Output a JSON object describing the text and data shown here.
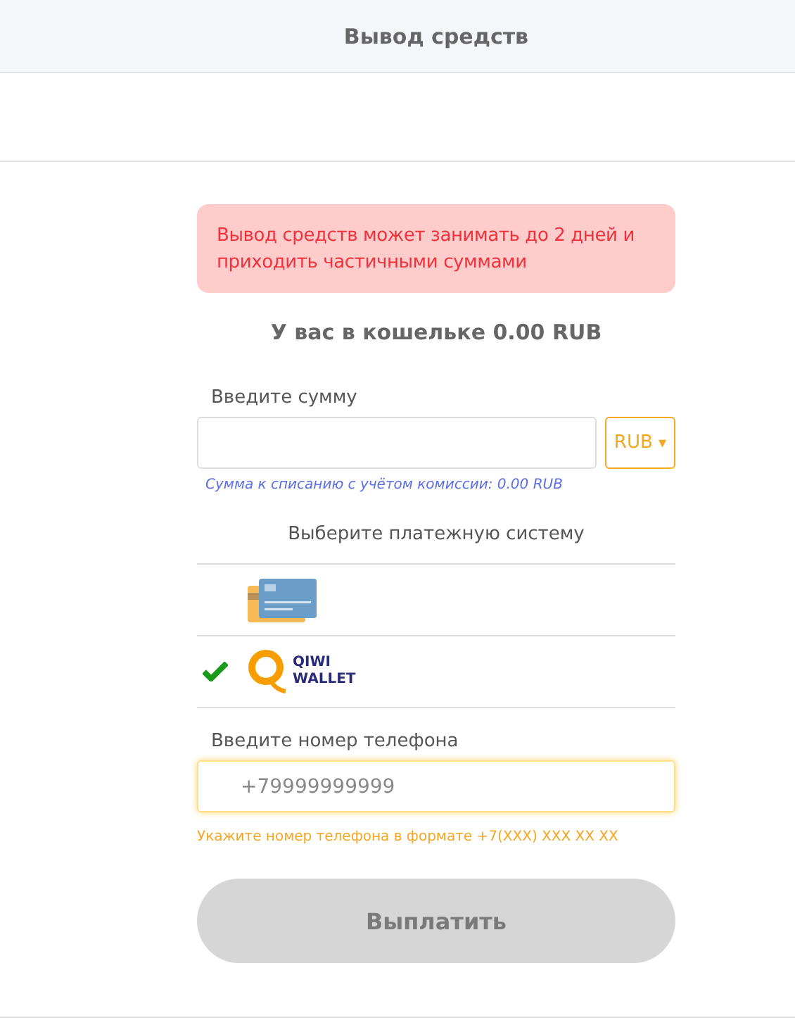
{
  "header": {
    "title": "Вывод средств"
  },
  "alert": "Вывод средств может занимать до 2 дней и приходить частичными суммами",
  "balance": "У вас в кошельке 0.00 RUB",
  "amount": {
    "label": "Введите сумму",
    "currency": "RUB",
    "caret": "▾",
    "hint": "Сумма к списанию с учётом комиссии: 0.00 RUB"
  },
  "payment": {
    "label": "Выберите платежную систему",
    "methods": [
      {
        "kind": "card",
        "selected": false
      },
      {
        "kind": "qiwi",
        "selected": true,
        "logo_lines": [
          "QIWI",
          "WALLET"
        ]
      }
    ]
  },
  "phone": {
    "label": "Введите номер телефона",
    "placeholder": "+79999999999",
    "focused": true,
    "hint": "Укажите номер телефона в формате +7(XXX) XXX XX XX"
  },
  "submit": {
    "label": "Выплатить",
    "disabled": true
  }
}
